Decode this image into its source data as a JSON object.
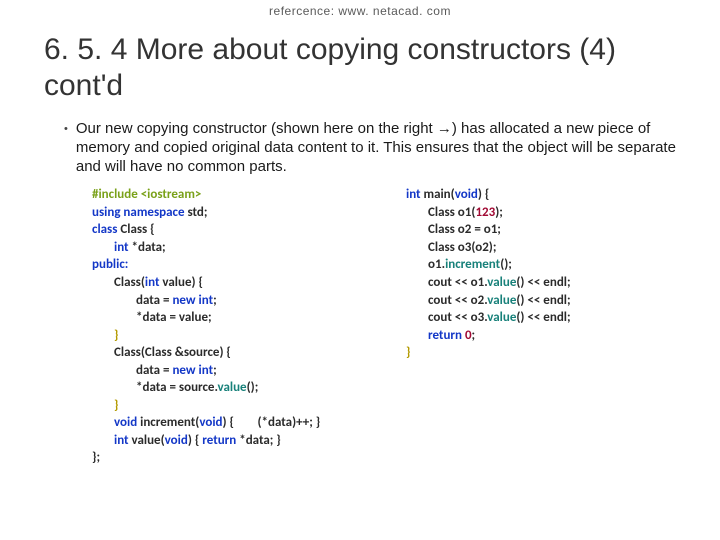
{
  "reference": "refercence: www. netacad. com",
  "title_line1": "6. 5. 4 More about copying constructors (4)",
  "title_line2": "cont'd",
  "bullet": "Our new copying constructor (shown here on the right →) has allocated a new piece of memory and copied original data content to it. This ensures that the object will be separate and will have no common parts.",
  "code_left": {
    "l0_pre": "#include <iostream>",
    "l1_kw": "using namespace ",
    "l1_rest": "std;",
    "l2_kw": "class ",
    "l2_rest": "Class {",
    "l3_kw": "int ",
    "l3_rest": "*data;",
    "l4_kw": "public:",
    "l5_name": "Class(",
    "l5_kw": "int ",
    "l5_rest": "value) {",
    "l6": "data = ",
    "l6_kw": "new int",
    "l6_semi": ";",
    "l7": "*data = value;",
    "l8_close": "}",
    "l9_name": "Class(Class &source) {",
    "l10": "data = ",
    "l10_kw": "new int",
    "l10_semi": ";",
    "l11a": "*data = source.",
    "l11b": "value",
    "l11c": "();",
    "l12_close": "}",
    "l13_kw": "void ",
    "l13_name": "increment(",
    "l13_kw2": "void",
    "l13_rest": ") {        (*data)++; }",
    "l14_kw": "int ",
    "l14_name": "value(",
    "l14_kw2": "void",
    "l14_rest": ") { ",
    "l14_ret": "return ",
    "l14_end": "*data; }",
    "l15": "};"
  },
  "code_right": {
    "r0_kw": "int ",
    "r0_main": "main(",
    "r0_void": "void",
    "r0_rest": ") {",
    "r1a": "Class o1(",
    "r1b": "123",
    "r1c": ");",
    "r2": "Class o2 = o1;",
    "r3": "Class o3(o2);",
    "r4a": "o1.",
    "r4b": "increment",
    "r4c": "();",
    "r5a": "cout << o1.",
    "r5b": "value",
    "r5c": "() << endl;",
    "r6a": "cout << o2.",
    "r6b": "value",
    "r6c": "() << endl;",
    "r7a": "cout << o3.",
    "r7b": "value",
    "r7c": "() << endl;",
    "r8_kw": "return ",
    "r8_num": "0",
    "r8_semi": ";",
    "r9": "}"
  }
}
